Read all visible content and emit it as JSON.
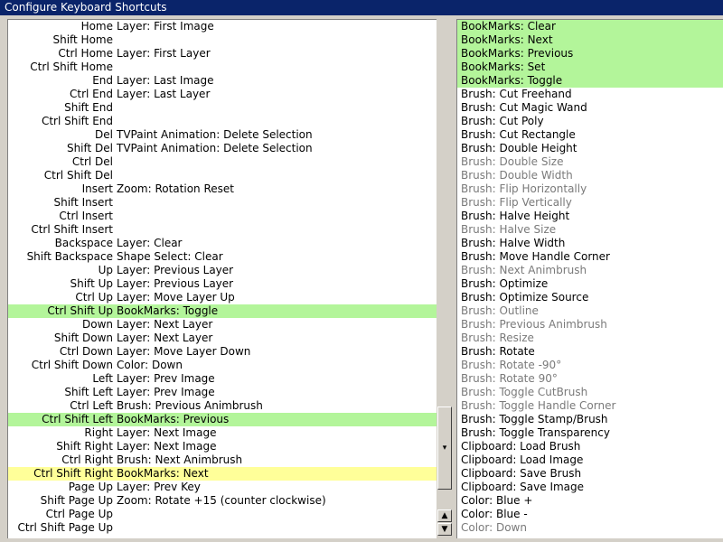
{
  "window": {
    "title": "Configure Keyboard Shortcuts"
  },
  "shortcuts": [
    {
      "key": "Home",
      "action": "Layer: First Image",
      "hl": ""
    },
    {
      "key": "Shift Home",
      "action": "",
      "hl": ""
    },
    {
      "key": "Ctrl Home",
      "action": "Layer: First Layer",
      "hl": ""
    },
    {
      "key": "Ctrl Shift Home",
      "action": "",
      "hl": ""
    },
    {
      "key": "End",
      "action": "Layer: Last Image",
      "hl": ""
    },
    {
      "key": "Ctrl End",
      "action": "Layer: Last Layer",
      "hl": ""
    },
    {
      "key": "Shift End",
      "action": "",
      "hl": ""
    },
    {
      "key": "Ctrl Shift End",
      "action": "",
      "hl": ""
    },
    {
      "key": "Del",
      "action": "TVPaint Animation: Delete Selection",
      "hl": ""
    },
    {
      "key": "Shift Del",
      "action": "TVPaint Animation: Delete Selection",
      "hl": ""
    },
    {
      "key": "Ctrl Del",
      "action": "",
      "hl": ""
    },
    {
      "key": "Ctrl Shift Del",
      "action": "",
      "hl": ""
    },
    {
      "key": "Insert",
      "action": "Zoom: Rotation Reset",
      "hl": ""
    },
    {
      "key": "Shift Insert",
      "action": "",
      "hl": ""
    },
    {
      "key": "Ctrl Insert",
      "action": "",
      "hl": ""
    },
    {
      "key": "Ctrl Shift Insert",
      "action": "",
      "hl": ""
    },
    {
      "key": "Backspace",
      "action": "Layer: Clear",
      "hl": ""
    },
    {
      "key": "Shift Backspace",
      "action": "Shape Select: Clear",
      "hl": ""
    },
    {
      "key": "Up",
      "action": "Layer: Previous Layer",
      "hl": ""
    },
    {
      "key": "Shift Up",
      "action": "Layer: Previous Layer",
      "hl": ""
    },
    {
      "key": "Ctrl Up",
      "action": "Layer: Move Layer Up",
      "hl": ""
    },
    {
      "key": "Ctrl Shift Up",
      "action": "BookMarks: Toggle",
      "hl": "green"
    },
    {
      "key": "Down",
      "action": "Layer: Next Layer",
      "hl": ""
    },
    {
      "key": "Shift Down",
      "action": "Layer: Next Layer",
      "hl": ""
    },
    {
      "key": "Ctrl Down",
      "action": "Layer: Move Layer Down",
      "hl": ""
    },
    {
      "key": "Ctrl Shift Down",
      "action": "Color: Down",
      "hl": ""
    },
    {
      "key": "Left",
      "action": "Layer: Prev Image",
      "hl": ""
    },
    {
      "key": "Shift Left",
      "action": "Layer: Prev Image",
      "hl": ""
    },
    {
      "key": "Ctrl Left",
      "action": "Brush: Previous Animbrush",
      "hl": ""
    },
    {
      "key": "Ctrl Shift Left",
      "action": "BookMarks: Previous",
      "hl": "green"
    },
    {
      "key": "Right",
      "action": "Layer: Next Image",
      "hl": ""
    },
    {
      "key": "Shift Right",
      "action": "Layer: Next Image",
      "hl": ""
    },
    {
      "key": "Ctrl Right",
      "action": "Brush: Next Animbrush",
      "hl": ""
    },
    {
      "key": "Ctrl Shift Right",
      "action": "BookMarks: Next",
      "hl": "yellow"
    },
    {
      "key": "Page Up",
      "action": "Layer: Prev Key",
      "hl": ""
    },
    {
      "key": "Shift Page Up",
      "action": "Zoom: Rotate +15 (counter clockwise)",
      "hl": ""
    },
    {
      "key": "Ctrl Page Up",
      "action": "",
      "hl": ""
    },
    {
      "key": "Ctrl Shift Page Up",
      "action": "",
      "hl": ""
    }
  ],
  "scrollbar": {
    "thumb_glyph": "▾",
    "up_glyph": "▲",
    "down_glyph": "▼"
  },
  "actions": [
    {
      "label": "BookMarks: Clear",
      "hl": "green",
      "dim": false
    },
    {
      "label": "BookMarks: Next",
      "hl": "green",
      "dim": false
    },
    {
      "label": "BookMarks: Previous",
      "hl": "green",
      "dim": false
    },
    {
      "label": "BookMarks: Set",
      "hl": "green",
      "dim": false
    },
    {
      "label": "BookMarks: Toggle",
      "hl": "green",
      "dim": false
    },
    {
      "label": "Brush: Cut Freehand",
      "hl": "",
      "dim": false
    },
    {
      "label": "Brush: Cut Magic Wand",
      "hl": "",
      "dim": false
    },
    {
      "label": "Brush: Cut Poly",
      "hl": "",
      "dim": false
    },
    {
      "label": "Brush: Cut Rectangle",
      "hl": "",
      "dim": false
    },
    {
      "label": "Brush: Double Height",
      "hl": "",
      "dim": false
    },
    {
      "label": "Brush: Double Size",
      "hl": "",
      "dim": true
    },
    {
      "label": "Brush: Double Width",
      "hl": "",
      "dim": true
    },
    {
      "label": "Brush: Flip Horizontally",
      "hl": "",
      "dim": true
    },
    {
      "label": "Brush: Flip Vertically",
      "hl": "",
      "dim": true
    },
    {
      "label": "Brush: Halve Height",
      "hl": "",
      "dim": false
    },
    {
      "label": "Brush: Halve Size",
      "hl": "",
      "dim": true
    },
    {
      "label": "Brush: Halve Width",
      "hl": "",
      "dim": false
    },
    {
      "label": "Brush: Move Handle Corner",
      "hl": "",
      "dim": false
    },
    {
      "label": "Brush: Next Animbrush",
      "hl": "",
      "dim": true
    },
    {
      "label": "Brush: Optimize",
      "hl": "",
      "dim": false
    },
    {
      "label": "Brush: Optimize Source",
      "hl": "",
      "dim": false
    },
    {
      "label": "Brush: Outline",
      "hl": "",
      "dim": true
    },
    {
      "label": "Brush: Previous Animbrush",
      "hl": "",
      "dim": true
    },
    {
      "label": "Brush: Resize",
      "hl": "",
      "dim": true
    },
    {
      "label": "Brush: Rotate",
      "hl": "",
      "dim": false
    },
    {
      "label": "Brush: Rotate -90°",
      "hl": "",
      "dim": true
    },
    {
      "label": "Brush: Rotate 90°",
      "hl": "",
      "dim": true
    },
    {
      "label": "Brush: Toggle CutBrush",
      "hl": "",
      "dim": true
    },
    {
      "label": "Brush: Toggle Handle Corner",
      "hl": "",
      "dim": true
    },
    {
      "label": "Brush: Toggle Stamp/Brush",
      "hl": "",
      "dim": false
    },
    {
      "label": "Brush: Toggle Transparency",
      "hl": "",
      "dim": false
    },
    {
      "label": "Clipboard: Load Brush",
      "hl": "",
      "dim": false
    },
    {
      "label": "Clipboard: Load Image",
      "hl": "",
      "dim": false
    },
    {
      "label": "Clipboard: Save Brush",
      "hl": "",
      "dim": false
    },
    {
      "label": "Clipboard: Save Image",
      "hl": "",
      "dim": false
    },
    {
      "label": "Color: Blue +",
      "hl": "",
      "dim": false
    },
    {
      "label": "Color: Blue -",
      "hl": "",
      "dim": false
    },
    {
      "label": "Color: Down",
      "hl": "",
      "dim": true
    }
  ],
  "colors": {
    "highlight_green": "#b3f59a",
    "highlight_yellow": "#ffff99",
    "titlebar": "#0a246a",
    "dim_text": "#7a7a7a"
  }
}
